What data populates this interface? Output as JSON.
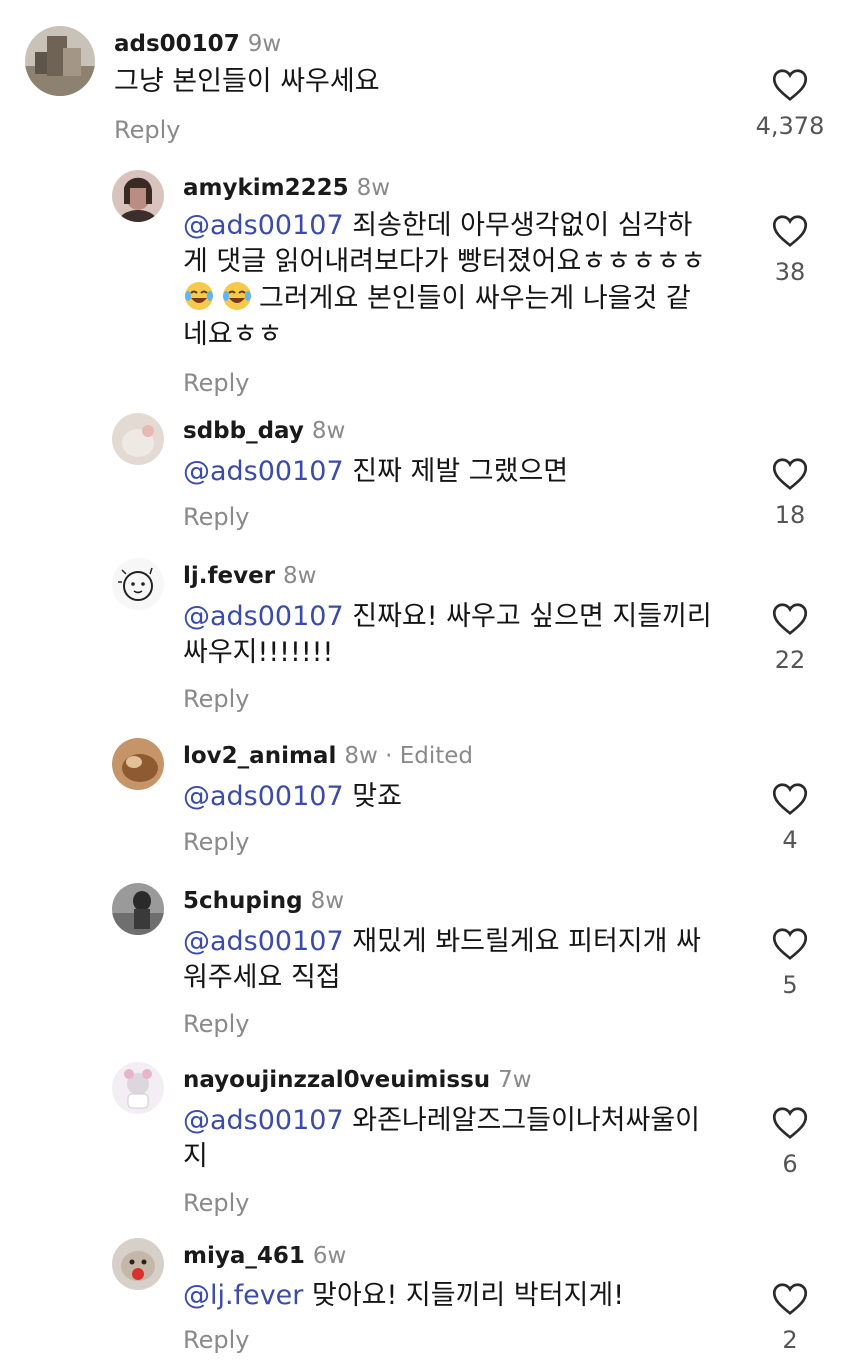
{
  "comments": [
    {
      "username": "ads00107",
      "time": "9w",
      "edited": "",
      "mention": "",
      "lines": [
        "그냥 본인들이 싸우세요"
      ],
      "reply_label": "Reply",
      "likes": "4,378",
      "avatar_color": "#9c8f7e"
    },
    {
      "username": "amykim2225",
      "time": "8w",
      "edited": "",
      "mention": "@ads00107",
      "lines": [
        " 죄송한데 아무생각없이 심각하",
        "게 댓글 읽어내려보다가 빵터졌어요ㅎㅎㅎㅎㅎ",
        "그러게요 본인들이 싸우는게 나을것 같",
        "네요ㅎㅎ"
      ],
      "emoji": [
        "face-with-tears-of-joy-icon",
        "face-with-tears-of-joy-icon"
      ],
      "reply_label": "Reply",
      "likes": "38",
      "avatar_color": "#b7928a"
    },
    {
      "username": "sdbb_day",
      "time": "8w",
      "edited": "",
      "mention": "@ads00107",
      "lines": [
        " 진짜 제발 그랬으면"
      ],
      "reply_label": "Reply",
      "likes": "18",
      "avatar_color": "#d9cfc6"
    },
    {
      "username": "lj.fever",
      "time": "8w",
      "edited": "",
      "mention": "@ads00107",
      "lines": [
        " 진짜요! 싸우고 싶으면 지들끼리",
        "싸우지!!!!!!!"
      ],
      "reply_label": "Reply",
      "likes": "22",
      "avatar_color": "#f4f4f4"
    },
    {
      "username": "lov2_animal",
      "time": "8w",
      "edited": " · Edited",
      "mention": "@ads00107",
      "lines": [
        " 맞죠"
      ],
      "reply_label": "Reply",
      "likes": "4",
      "avatar_color": "#b07a4a"
    },
    {
      "username": "5chuping",
      "time": "8w",
      "edited": "",
      "mention": "@ads00107",
      "lines": [
        " 재밌게 봐드릴게요 피터지개 싸",
        "워주세요 직접"
      ],
      "reply_label": "Reply",
      "likes": "5",
      "avatar_color": "#6e6e6e"
    },
    {
      "username": "nayoujinzzal0veuimissu",
      "time": "7w",
      "edited": "",
      "mention": "@ads00107",
      "lines": [
        " 와존나레알즈그들이나처싸울이",
        "지"
      ],
      "reply_label": "Reply",
      "likes": "6",
      "avatar_color": "#efe6ee"
    },
    {
      "username": "miya_461",
      "time": "6w",
      "edited": "",
      "mention": "@lj.fever",
      "lines": [
        " 맞아요!  지들끼리 박터지게!"
      ],
      "reply_label": "Reply",
      "likes": "2",
      "avatar_color": "#c9c2bb"
    }
  ],
  "icons": {
    "like": "heart-outline-icon"
  }
}
